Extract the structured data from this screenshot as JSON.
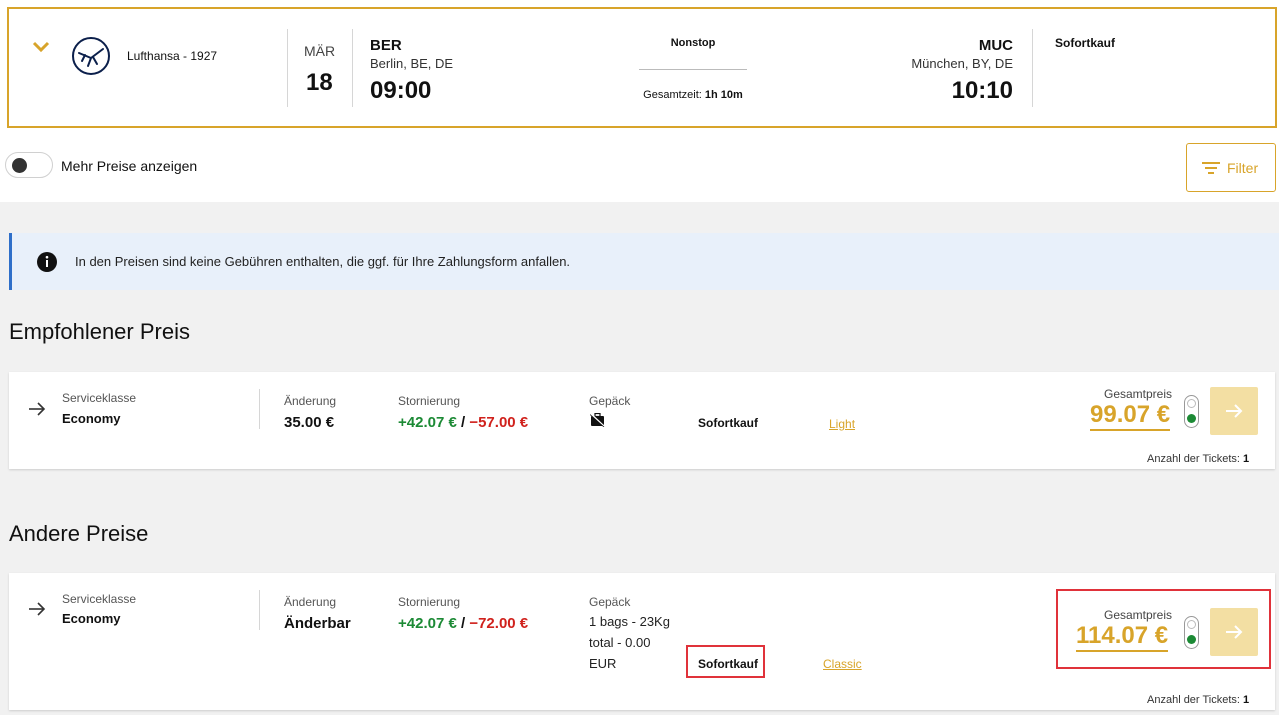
{
  "flight": {
    "airline": "Lufthansa - 1927",
    "month": "MÄR",
    "day": "18",
    "origin": {
      "code": "BER",
      "city": "Berlin, BE, DE",
      "time": "09:00"
    },
    "destination": {
      "code": "MUC",
      "city": "München, BY, DE",
      "time": "10:10"
    },
    "stops": "Nonstop",
    "duration_label": "Gesamtzeit:",
    "duration_value": "1h 10m",
    "booking_type": "Sofortkauf"
  },
  "toggle_label": "Mehr Preise anzeigen",
  "filter_label": "Filter",
  "info_text": "In den Preisen sind keine Gebühren enthalten, die ggf. für Ihre Zahlungsform anfallen.",
  "sections": {
    "recommended": "Empfohlener Preis",
    "other": "Andere Preise"
  },
  "labels": {
    "serviceklasse": "Serviceklasse",
    "aenderung": "Änderung",
    "stornierung": "Stornierung",
    "gepaeck": "Gepäck",
    "gesamtpreis": "Gesamtpreis",
    "tickets": "Anzahl der Tickets:",
    "slash": "/"
  },
  "offers": [
    {
      "service_class": "Economy",
      "change": "35.00 €",
      "cancel_plus": "+42.07 €",
      "cancel_minus": "−57.00 €",
      "baggage": "",
      "booking": "Sofortkauf",
      "fare": "Light",
      "price": "99.07 €",
      "tickets": "1"
    },
    {
      "service_class": "Economy",
      "change": "Änderbar",
      "cancel_plus": "+42.07 €",
      "cancel_minus": "−72.00 €",
      "baggage_lines": [
        "1 bags - 23Kg",
        "total - 0.00",
        "EUR"
      ],
      "booking": "Sofortkauf",
      "fare": "Classic",
      "price": "114.07 €",
      "tickets": "1"
    }
  ],
  "colors": {
    "accent": "#d8a42a",
    "positive": "#1c8a35",
    "negative": "#d0211c",
    "info_bg": "#e8f0fa",
    "highlight": "#e0323a"
  }
}
